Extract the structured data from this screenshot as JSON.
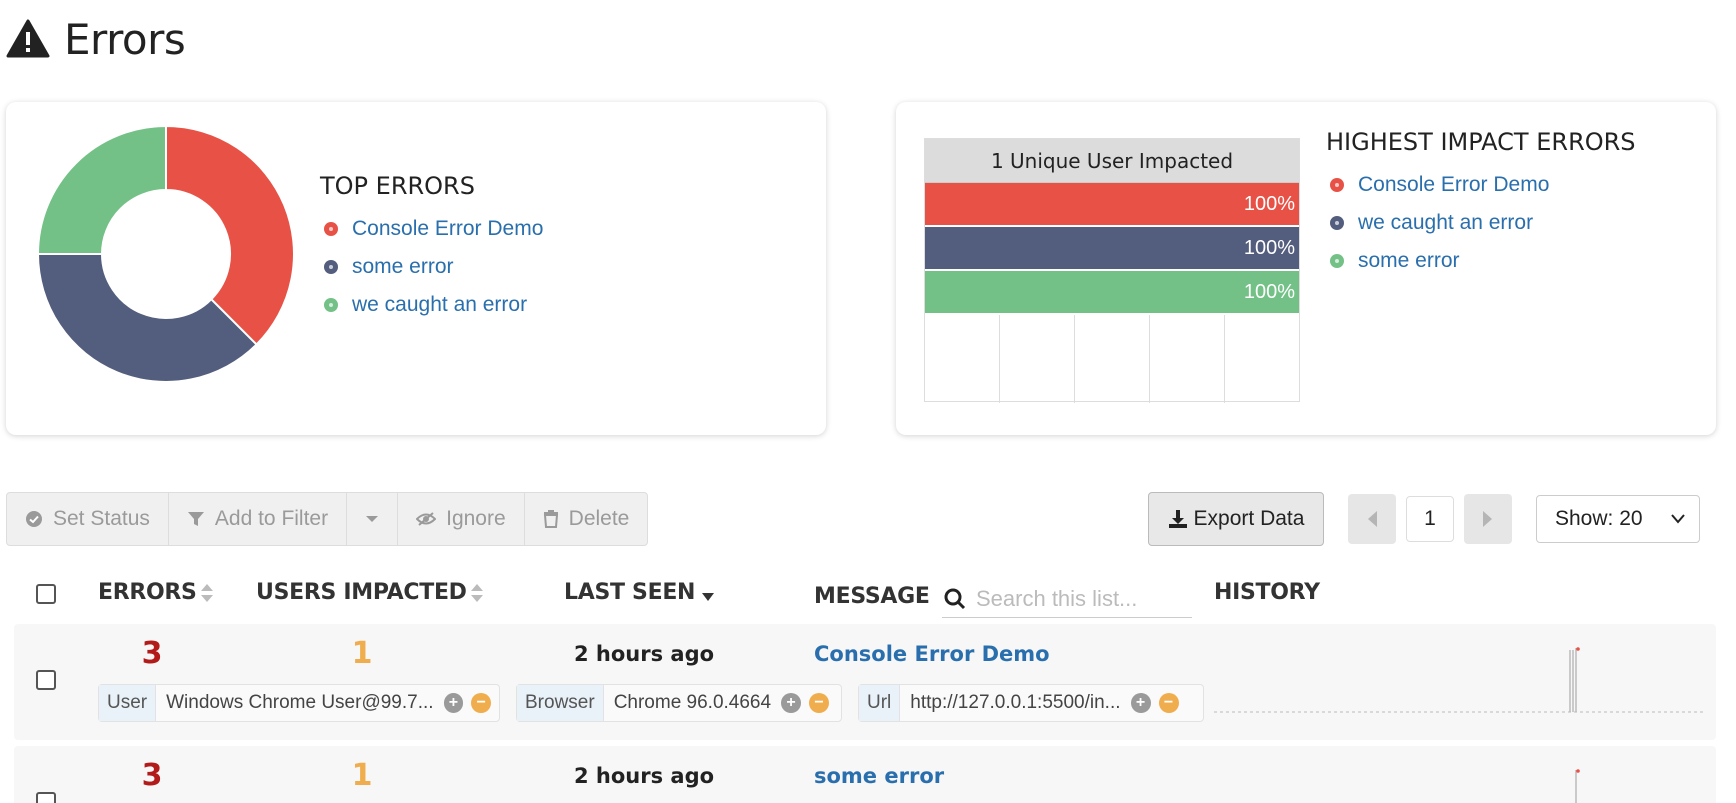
{
  "page": {
    "title": "Errors"
  },
  "top_errors": {
    "title": "TOP ERRORS",
    "items": [
      {
        "label": "Console Error Demo",
        "color": "#e85246"
      },
      {
        "label": "some error",
        "color": "#535d7d"
      },
      {
        "label": "we caught an error",
        "color": "#73c186"
      }
    ]
  },
  "highest_impact": {
    "title": "HIGHEST IMPACT ERRORS",
    "header": "1 Unique User Impacted",
    "items": [
      {
        "label": "Console Error Demo",
        "color": "#e85246"
      },
      {
        "label": "we caught an error",
        "color": "#535d7d"
      },
      {
        "label": "some error",
        "color": "#73c186"
      }
    ]
  },
  "chart_data": [
    {
      "type": "pie",
      "variant": "donut",
      "title": "TOP ERRORS",
      "categories": [
        "Console Error Demo",
        "some error",
        "we caught an error"
      ],
      "values": [
        3,
        3,
        2
      ],
      "colors": [
        "#e85246",
        "#535d7d",
        "#73c186"
      ]
    },
    {
      "type": "bar",
      "orientation": "horizontal",
      "title": "1 Unique User Impacted",
      "categories": [
        "Console Error Demo",
        "we caught an error",
        "some error"
      ],
      "values": [
        100,
        100,
        100
      ],
      "labels": [
        "100%",
        "100%",
        "100%"
      ],
      "colors": [
        "#e85246",
        "#535d7d",
        "#73c186"
      ],
      "xlim": [
        0,
        100
      ]
    }
  ],
  "toolbar": {
    "set_status": "Set Status",
    "add_to_filter": "Add to Filter",
    "ignore": "Ignore",
    "delete": "Delete"
  },
  "export": {
    "label": "Export Data"
  },
  "pagination": {
    "page": "1",
    "show": "Show: 20"
  },
  "table": {
    "headers": {
      "errors": "ERRORS",
      "users": "USERS IMPACTED",
      "last_seen": "LAST SEEN",
      "message": "MESSAGE",
      "history": "HISTORY"
    },
    "search_placeholder": "Search this list...",
    "colors": {
      "errors": "#b31b1b",
      "users": "#f0ad4e"
    },
    "rows": [
      {
        "errors": "3",
        "users": "1",
        "last_seen": "2 hours ago",
        "message": "Console Error Demo",
        "tags": [
          {
            "key": "User",
            "value": "Windows Chrome User@99.7..."
          },
          {
            "key": "Browser",
            "value": "Chrome 96.0.4664"
          },
          {
            "key": "Url",
            "value": "http://127.0.0.1:5500/in..."
          }
        ]
      },
      {
        "errors": "3",
        "users": "1",
        "last_seen": "2 hours ago",
        "message": "some error"
      }
    ]
  }
}
